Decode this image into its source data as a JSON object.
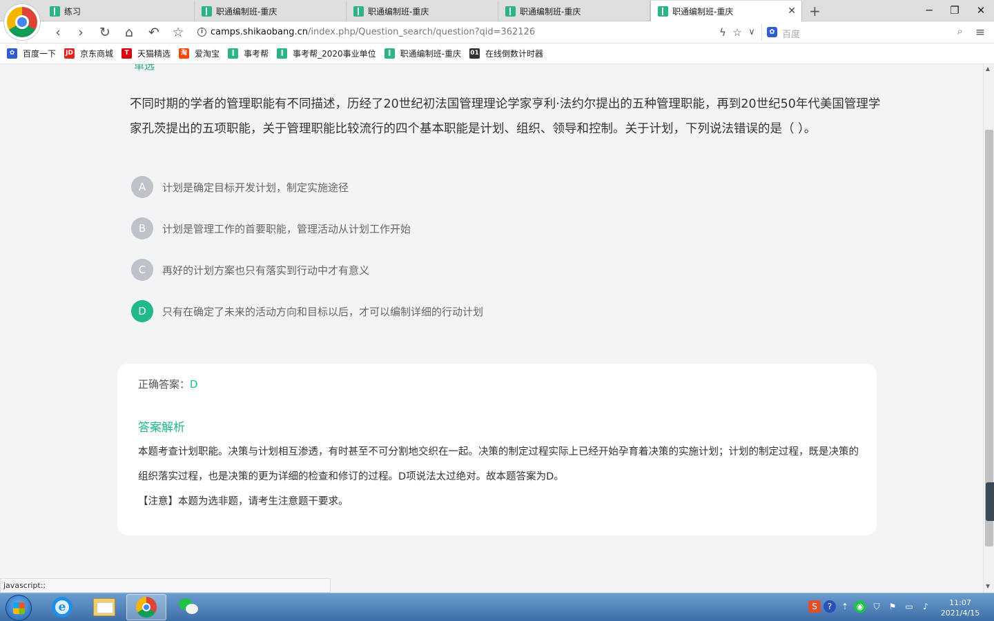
{
  "browser": {
    "tabs": [
      {
        "label": "练习",
        "active": false
      },
      {
        "label": "职通编制班-重庆",
        "active": false
      },
      {
        "label": "职通编制班-重庆",
        "active": false
      },
      {
        "label": "职通编制班-重庆",
        "active": false
      },
      {
        "label": "职通编制班-重庆",
        "active": true
      }
    ],
    "address": {
      "host": "camps.shikaobang.cn",
      "path": "/index.php/Question_search/question?qid=362126"
    },
    "search_placeholder": "百度",
    "bookmarks": [
      {
        "label": "百度一下",
        "icon": "paw-icon",
        "color": "#2f5bd8",
        "glyph": "✿"
      },
      {
        "label": "京东商城",
        "icon": "jd-icon",
        "color": "#e1251b",
        "glyph": "JD"
      },
      {
        "label": "天猫精选",
        "icon": "tmall-icon",
        "color": "#d8000f",
        "glyph": "T"
      },
      {
        "label": "爱淘宝",
        "icon": "taobao-icon",
        "color": "#ff4400",
        "glyph": "淘"
      },
      {
        "label": "事考帮",
        "icon": "shikaobang-icon",
        "color": "#2db38a",
        "glyph": "‖"
      },
      {
        "label": "事考帮_2020事业单位",
        "icon": "shikaobang-icon",
        "color": "#2db38a",
        "glyph": "‖"
      },
      {
        "label": "职通编制班-重庆",
        "icon": "shikaobang-icon",
        "color": "#2db38a",
        "glyph": "‖"
      },
      {
        "label": "在线倒数计时器",
        "icon": "timer-icon",
        "color": "#333333",
        "glyph": "01"
      }
    ]
  },
  "page": {
    "clipped_tag": "单选",
    "question": "不同时期的学者的管理职能有不同描述，历经了20世纪初法国管理理论学家亨利·法约尔提出的五种管理职能，再到20世纪50年代美国管理学家孔茨提出的五项职能，关于管理职能比较流行的四个基本职能是计划、组织、领导和控制。关于计划，下列说法错误的是（  ）。",
    "options": [
      {
        "letter": "A",
        "text": "计划是确定目标开发计划，制定实施途径",
        "correct": false
      },
      {
        "letter": "B",
        "text": "计划是管理工作的首要职能，管理活动从计划工作开始",
        "correct": false
      },
      {
        "letter": "C",
        "text": "再好的计划方案也只有落实到行动中才有意义",
        "correct": false
      },
      {
        "letter": "D",
        "text": "只有在确定了未来的活动方向和目标以后，才可以编制详细的行动计划",
        "correct": true
      }
    ],
    "answer_label": "正确答案：",
    "answer_value": "D",
    "analysis_title": "答案解析",
    "analysis_body": "本题考查计划职能。决策与计划相互渗透，有时甚至不可分割地交织在一起。决策的制定过程实际上已经开始孕育着决策的实施计划；计划的制定过程，既是决策的组织落实过程，也是决策的更为详细的检查和修订的过程。D项说法太过绝对。故本题答案为D。",
    "note": "【注意】本题为选非题，请考生注意题干要求。",
    "accent_color": "#20b98a"
  },
  "status_text": "javascript:;",
  "taskbar": {
    "time": "11:07",
    "date": "2021/4/15"
  }
}
